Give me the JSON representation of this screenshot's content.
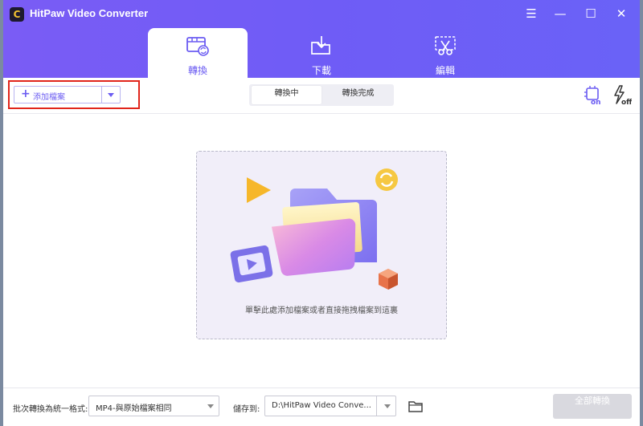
{
  "window": {
    "title": "HitPaw Video Converter",
    "logo_letter": "C",
    "controls": {
      "menu": "☰",
      "minimize": "—",
      "maximize": "☐",
      "close": "✕"
    }
  },
  "tabs": [
    {
      "label": "轉換",
      "icon": "convert-film-icon",
      "active": true
    },
    {
      "label": "下載",
      "icon": "download-folder-icon",
      "active": false
    },
    {
      "label": "編輯",
      "icon": "edit-scissors-icon",
      "active": false
    }
  ],
  "toolbar": {
    "add_file_plus": "+",
    "add_file_label": "添加檔案",
    "segments": [
      {
        "label": "轉換中",
        "selected": true
      },
      {
        "label": "轉換完成",
        "selected": false
      }
    ],
    "hw_accel_label": "on",
    "lightning_label": "off"
  },
  "dropzone": {
    "hint": "單擊此處添加檔案或者直接拖拽檔案到這裏"
  },
  "footer": {
    "format_label": "批次轉換為統一格式:",
    "format_value": "MP4-與原始檔案相同",
    "save_label": "儲存到:",
    "save_value": "D:\\HitPaw Video Conve...",
    "convert_all_label": "全部轉換"
  },
  "colors": {
    "accent": "#6b5cf2",
    "titlebar": "#7060f5",
    "highlight_box": "#e1251b",
    "disabled_button": "#d9d9df"
  }
}
